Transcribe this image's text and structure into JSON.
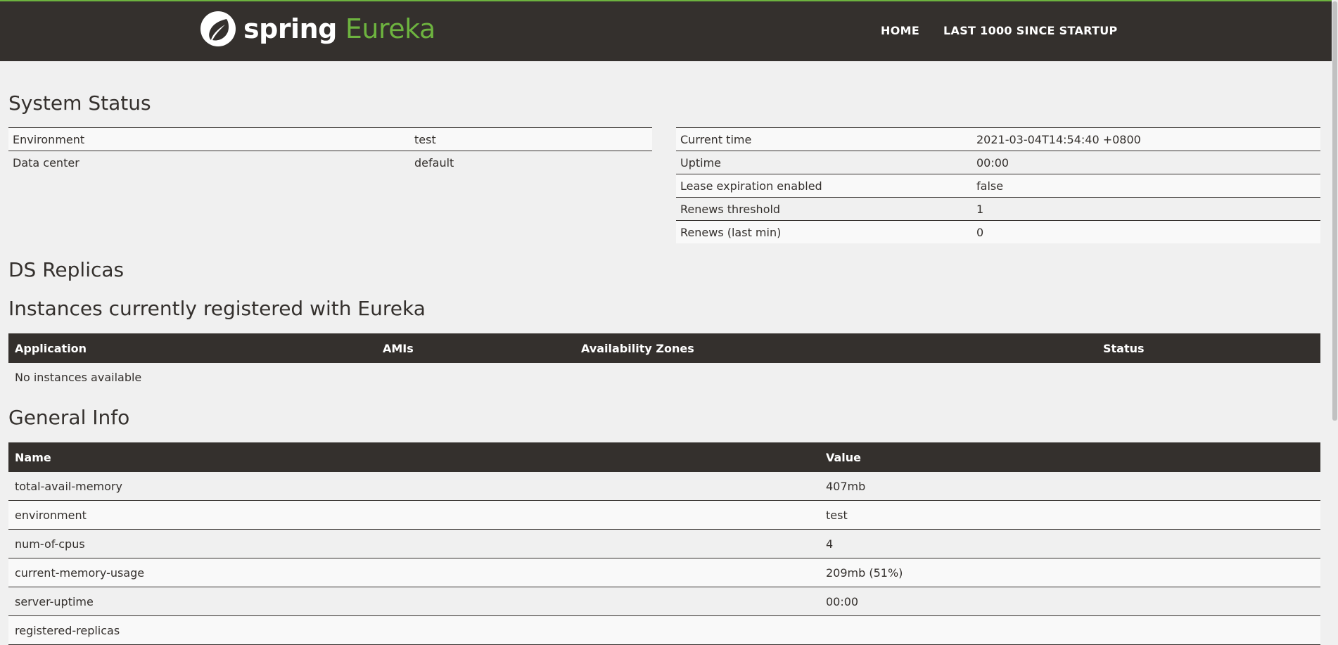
{
  "brand": {
    "spring": "spring",
    "eureka": "Eureka"
  },
  "nav": {
    "home": "HOME",
    "last1000": "LAST 1000 SINCE STARTUP"
  },
  "system_status": {
    "title": "System Status",
    "left": [
      {
        "label": "Environment",
        "value": "test"
      },
      {
        "label": "Data center",
        "value": "default"
      }
    ],
    "right": [
      {
        "label": "Current time",
        "value": "2021-03-04T14:54:40 +0800"
      },
      {
        "label": "Uptime",
        "value": "00:00"
      },
      {
        "label": "Lease expiration enabled",
        "value": "false"
      },
      {
        "label": "Renews threshold",
        "value": "1"
      },
      {
        "label": "Renews (last min)",
        "value": "0"
      }
    ]
  },
  "ds_replicas": {
    "title": "DS Replicas"
  },
  "instances": {
    "title": "Instances currently registered with Eureka",
    "columns": [
      "Application",
      "AMIs",
      "Availability Zones",
      "Status"
    ],
    "empty_text": "No instances available"
  },
  "general_info": {
    "title": "General Info",
    "columns": [
      "Name",
      "Value"
    ],
    "rows": [
      {
        "name": "total-avail-memory",
        "value": "407mb"
      },
      {
        "name": "environment",
        "value": "test"
      },
      {
        "name": "num-of-cpus",
        "value": "4"
      },
      {
        "name": "current-memory-usage",
        "value": "209mb (51%)"
      },
      {
        "name": "server-uptime",
        "value": "00:00"
      },
      {
        "name": "registered-replicas",
        "value": ""
      }
    ]
  },
  "colors": {
    "header_bg": "#34302d",
    "accent": "#6db33f",
    "page_bg": "#f0f0f0"
  }
}
